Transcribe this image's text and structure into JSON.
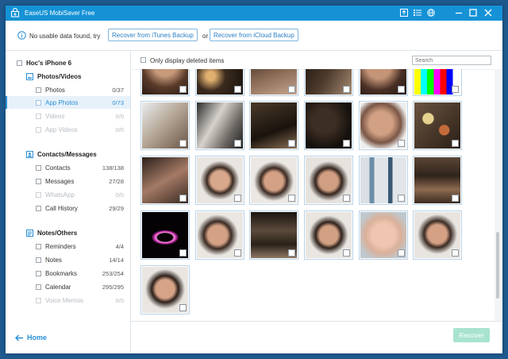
{
  "titlebar": {
    "title": "EaseUS MobiSaver Free"
  },
  "infobar": {
    "message": "No usable data found, try",
    "itunes_button": "Recover from iTunes Backup",
    "or_text": "or",
    "icloud_button": "Recover from iCloud Backup"
  },
  "sidebar": {
    "device": "Hoc's iPhone 6",
    "photos_videos": {
      "title": "Photos/Videos",
      "items": [
        {
          "label": "Photos",
          "count": "0/37"
        },
        {
          "label": "App Photos",
          "count": "0/73"
        },
        {
          "label": "Videos",
          "count": "0/0"
        },
        {
          "label": "App Videos",
          "count": "0/0"
        }
      ]
    },
    "contacts_messages": {
      "title": "Contacts/Messages",
      "items": [
        {
          "label": "Contacts",
          "count": "138/138"
        },
        {
          "label": "Messages",
          "count": "27/28"
        },
        {
          "label": "WhatsApp",
          "count": "0/0"
        },
        {
          "label": "Call History",
          "count": "29/29"
        }
      ]
    },
    "notes_others": {
      "title": "Notes/Others",
      "items": [
        {
          "label": "Reminders",
          "count": "4/4"
        },
        {
          "label": "Notes",
          "count": "14/14"
        },
        {
          "label": "Bookmarks",
          "count": "253/254"
        },
        {
          "label": "Calendar",
          "count": "295/295"
        },
        {
          "label": "Voice Memos",
          "count": "0/0"
        }
      ]
    },
    "home_label": "Home"
  },
  "content": {
    "only_deleted_label": "Only display deleted items",
    "search_placeholder": "Search",
    "recover_label": "Recover"
  },
  "colors": {
    "titlebar": "#1592d6",
    "accent": "#2a8fd6",
    "recover_disabled": "#a9e3cf"
  }
}
